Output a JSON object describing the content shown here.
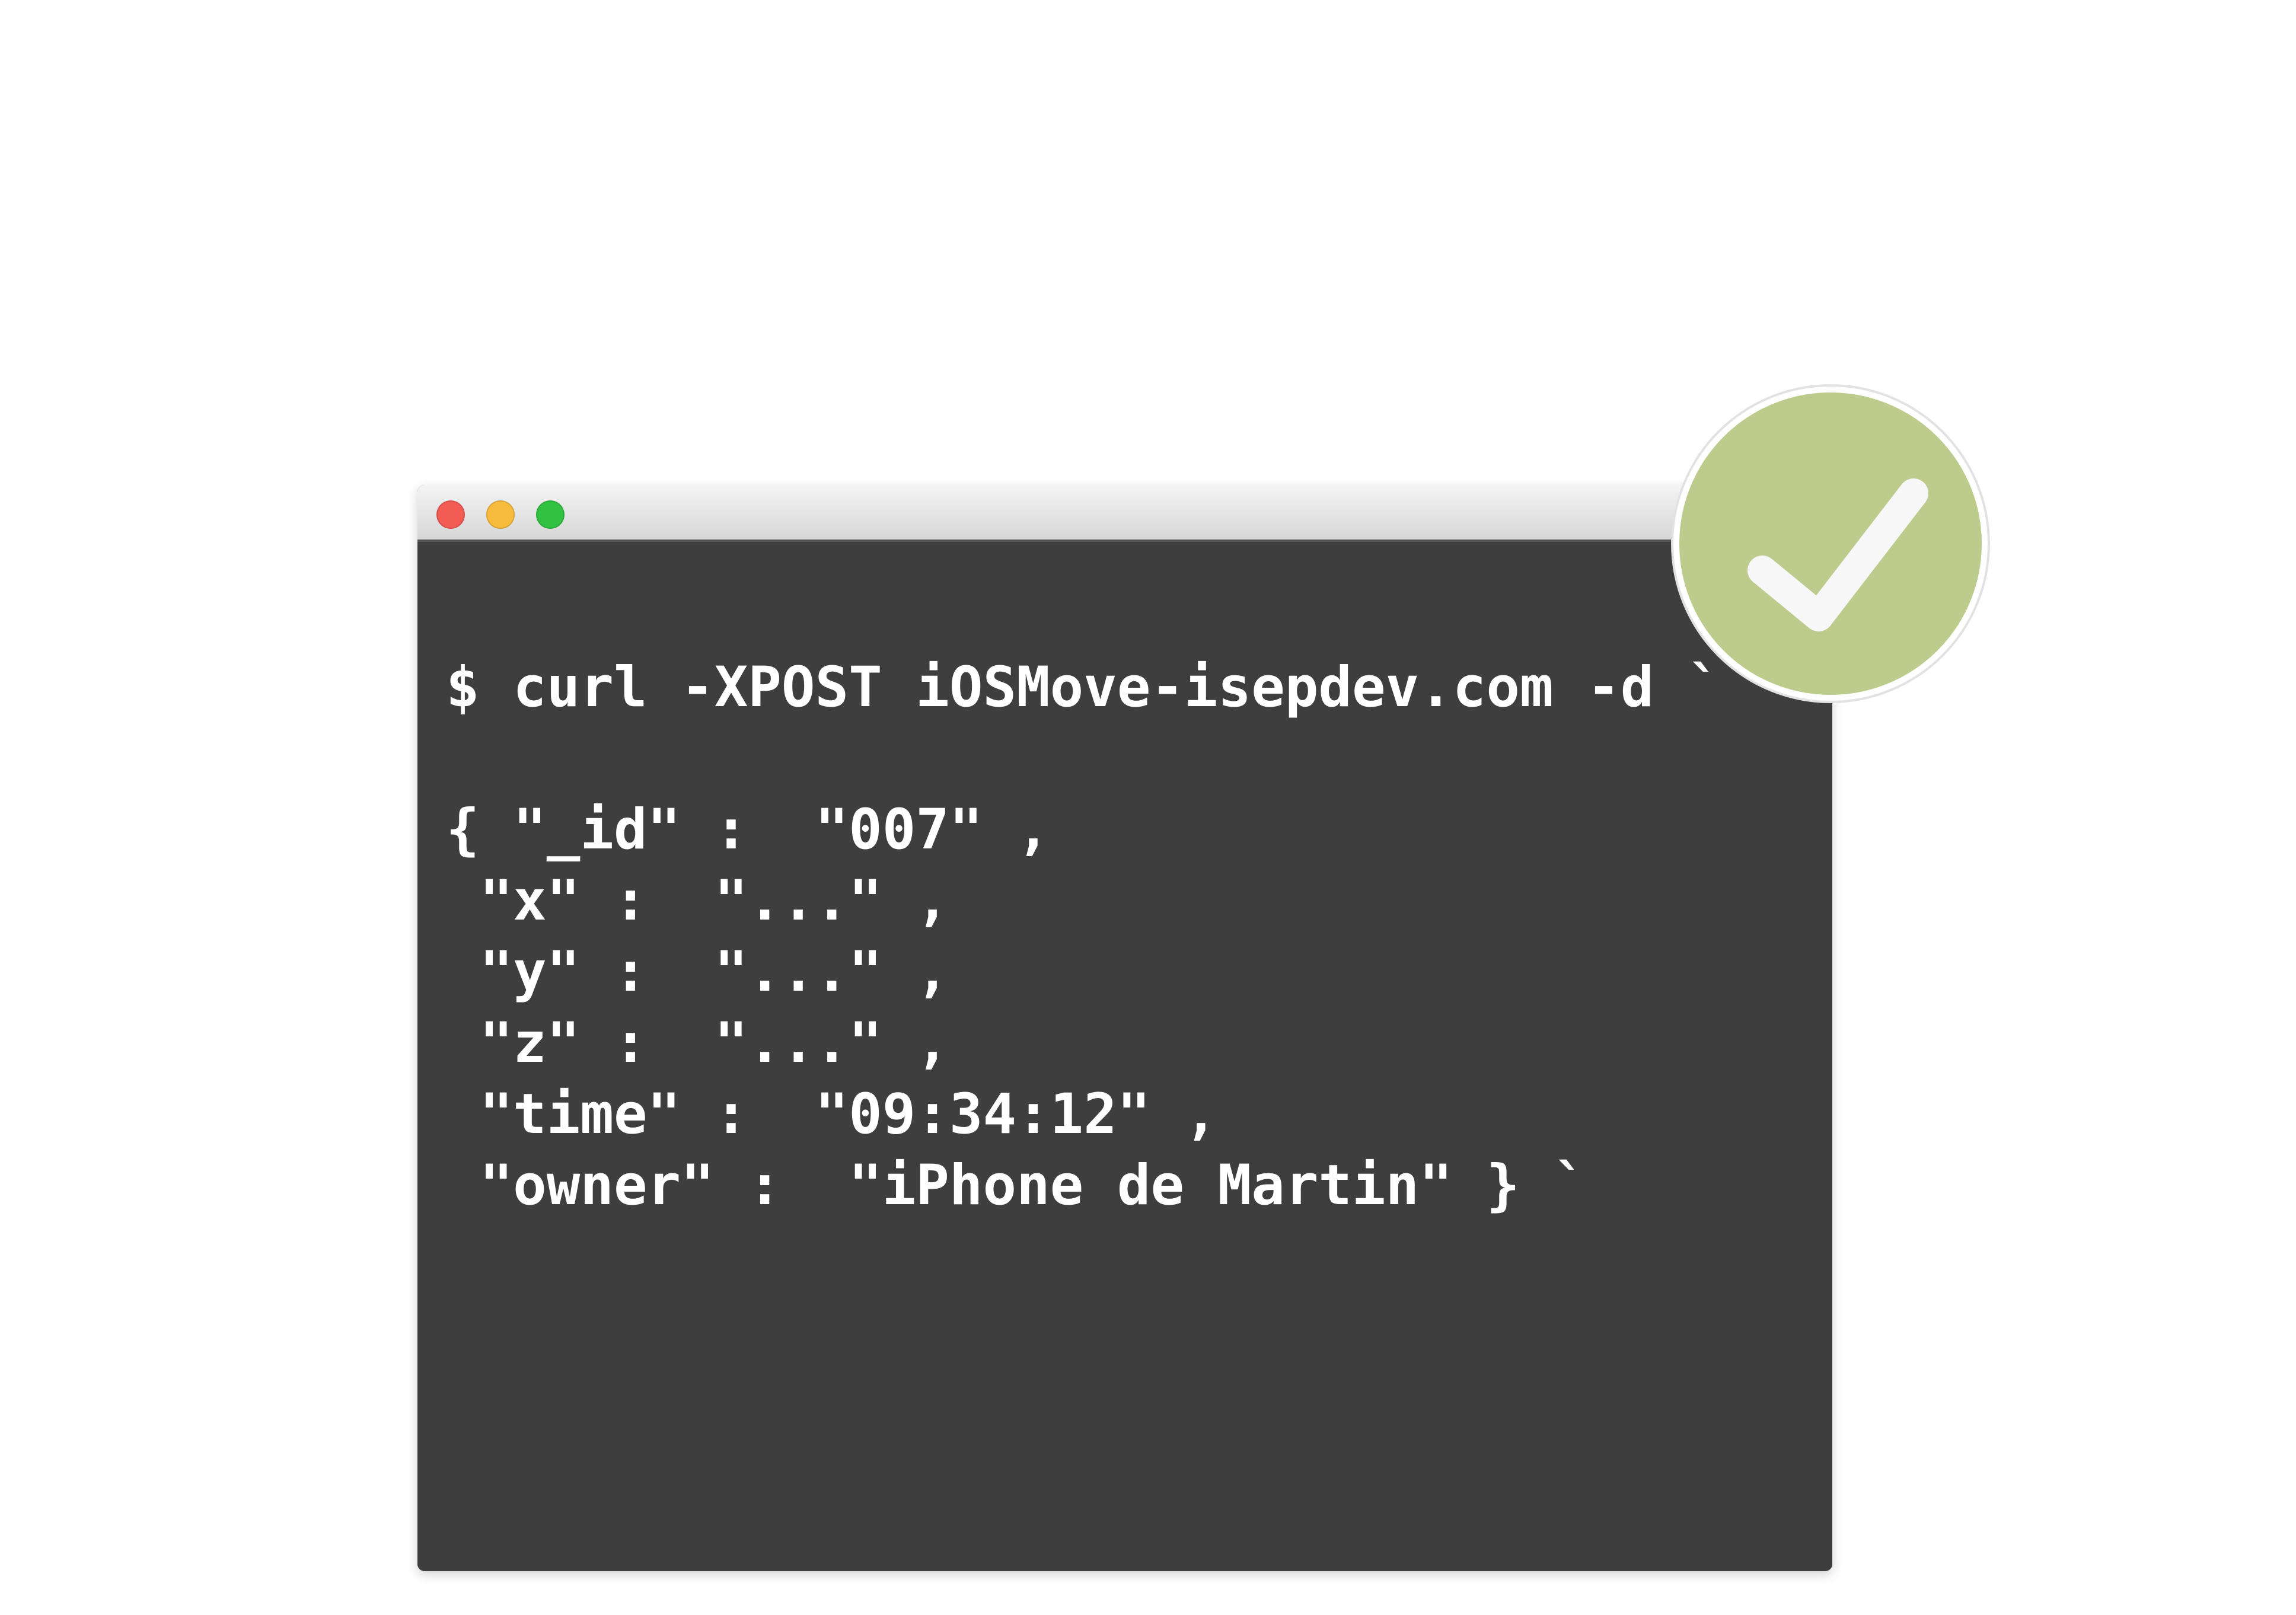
{
  "terminal": {
    "command_line": "$ curl -XPOST iOSMove-isepdev.com -d `",
    "payload_lines": [
      "{ \"_id\" :  \"007\" ,",
      " \"x\" :  \"...\" ,",
      " \"y\" :  \"...\" ,",
      " \"z\" :  \"...\" ,",
      " \"time\" :  \"09:34:12\" ,",
      " \"owner\" :  \"iPhone de Martin\" } `"
    ]
  },
  "badge": {
    "icon": "checkmark-icon",
    "color": "#bdcb8c"
  },
  "window_controls": [
    "close",
    "minimize",
    "zoom"
  ],
  "colors": {
    "terminal_background": "#3e3e3e",
    "text": "#ffffff",
    "close": "#f25c55",
    "minimize": "#f8bb3d",
    "zoom": "#31c241"
  }
}
